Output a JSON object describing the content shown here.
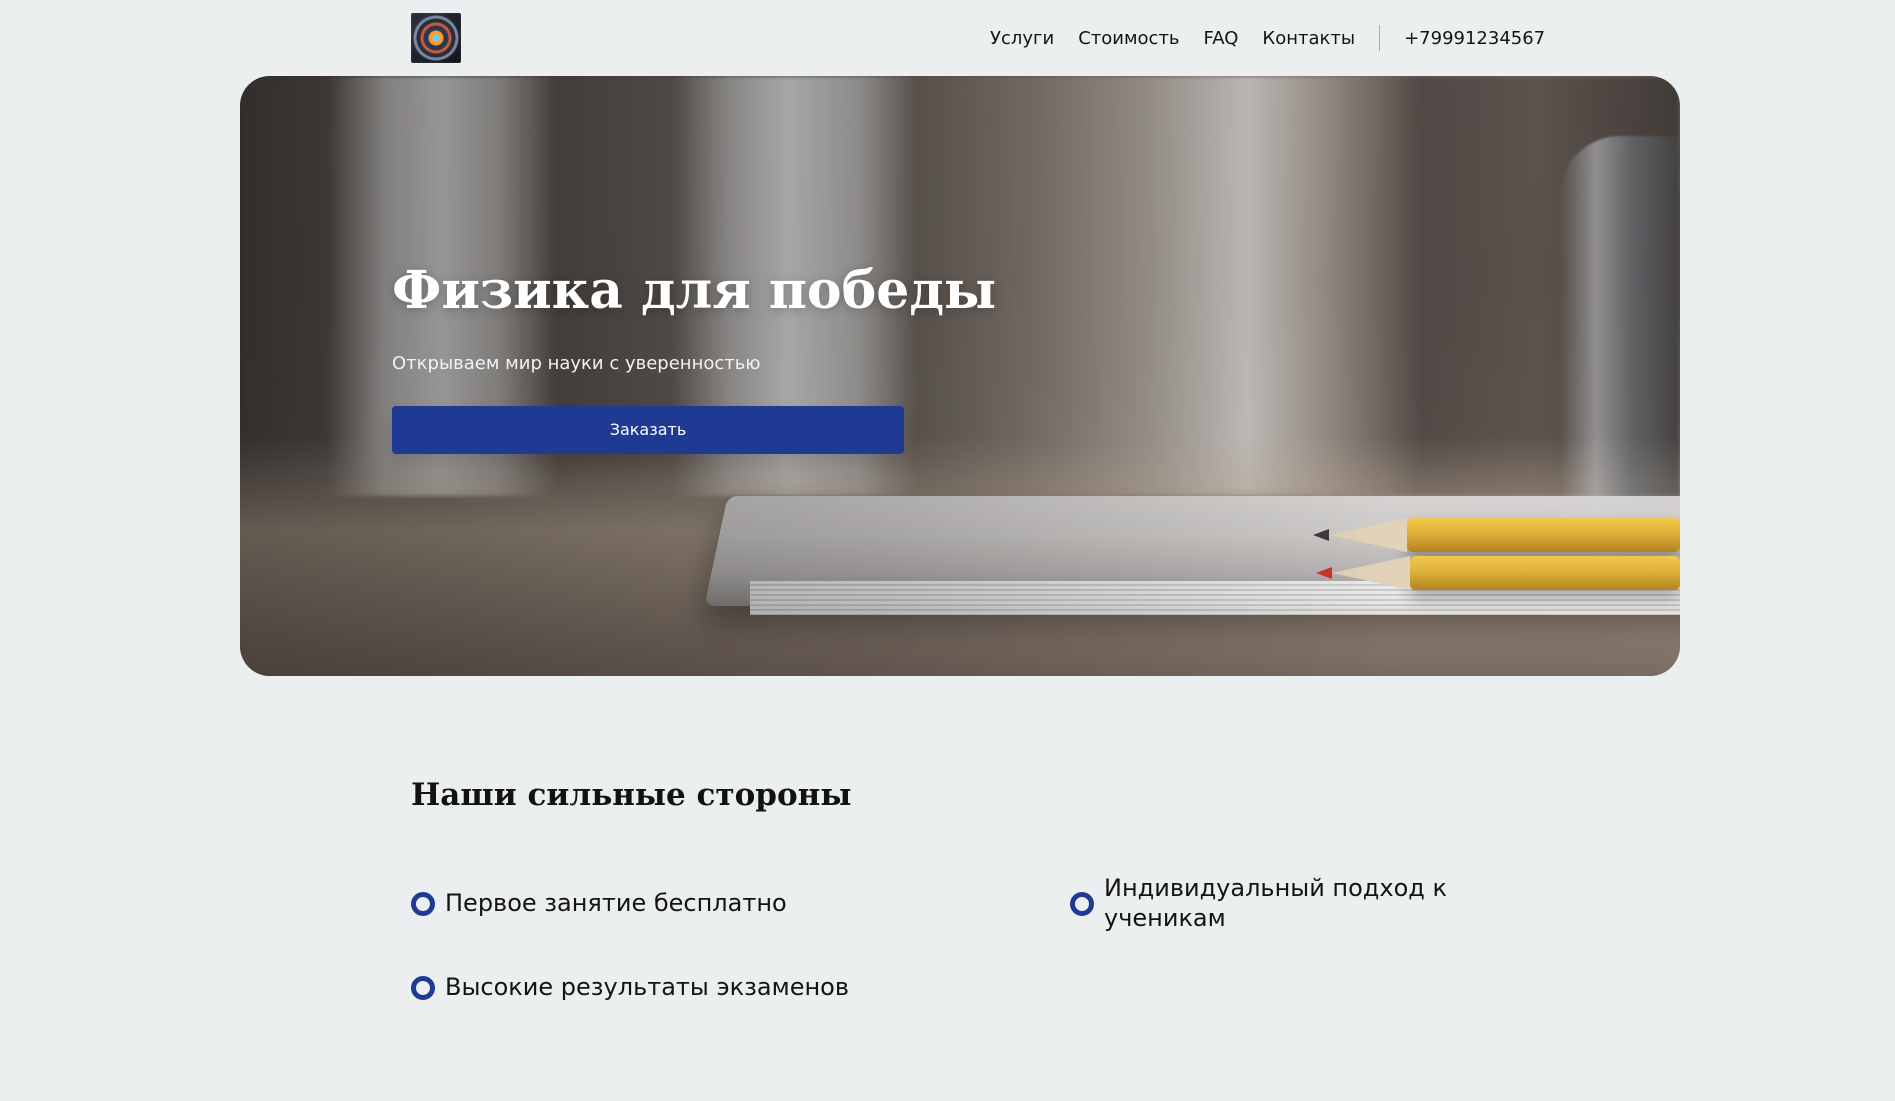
{
  "header": {
    "nav": [
      {
        "label": "Услуги"
      },
      {
        "label": "Стоимость"
      },
      {
        "label": "FAQ"
      },
      {
        "label": "Контакты"
      }
    ],
    "phone": "+79991234567"
  },
  "hero": {
    "title": "Физика для победы",
    "subtitle": "Открываем мир науки с уверенностью",
    "cta_label": "Заказать"
  },
  "strengths": {
    "title": "Наши сильные стороны",
    "items": [
      {
        "text": "Первое занятие бесплатно"
      },
      {
        "text": "Индивидуальный подход к ученикам"
      },
      {
        "text": "Высокие результаты экзаменов"
      }
    ]
  },
  "colors": {
    "background": "#ECEFF0",
    "accent": "#1F3A93",
    "text": "#141414",
    "hero_text": "#FFFFFF"
  },
  "icons": {
    "logo": "round-emblem-icon",
    "list_bullet": "ring-bullet-icon"
  }
}
